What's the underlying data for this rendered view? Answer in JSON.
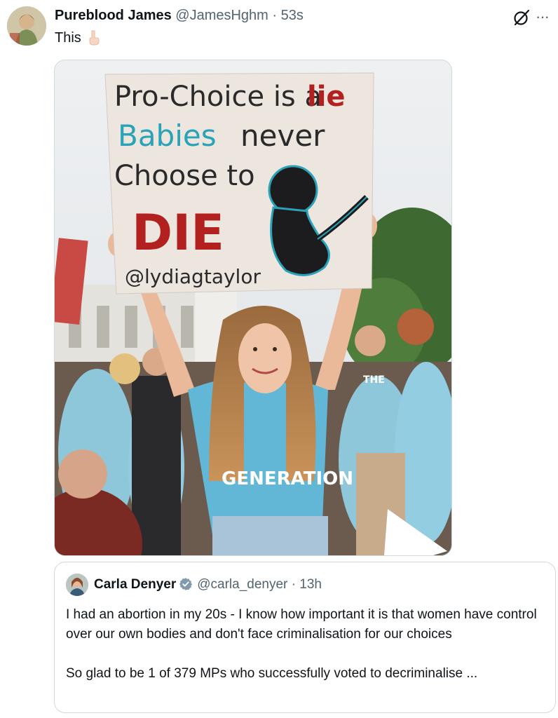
{
  "tweet": {
    "display_name": "Pureblood James",
    "handle": "@JamesHghm",
    "separator": "·",
    "time": "53s",
    "text": "This",
    "more_label": "···",
    "media": {
      "sign_line1a": "Pro-Choice is a",
      "sign_line1b": "lie",
      "sign_line2a": "Babies",
      "sign_line2b": "never",
      "sign_line3": "Choose to",
      "sign_line4": "DIE",
      "sign_handle": "@lydiagtaylor",
      "shirt_text": "GENERATION",
      "shirt_text2": "THE"
    }
  },
  "quoted": {
    "display_name": "Carla Denyer",
    "handle": "@carla_denyer",
    "separator": "·",
    "time": "13h",
    "paragraph1": "I had an abortion in my 20s - I know how important it is that women have control over our own bodies and don't face criminalisation for our choices",
    "paragraph2": "So glad to be 1 of 379 MPs who successfully voted to decriminalise ..."
  },
  "colors": {
    "verified": "#829aab",
    "link_gray": "#536471",
    "shirt_blue": "#7ec6e0",
    "sign_red": "#b32020",
    "sign_teal": "#2aa3b8"
  }
}
